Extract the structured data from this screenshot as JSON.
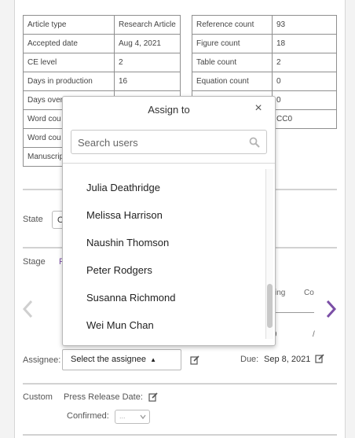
{
  "metadata_left": [
    {
      "key": "Article type",
      "value": "Research Article"
    },
    {
      "key": "Accepted date",
      "value": "Aug 4, 2021"
    },
    {
      "key": "CE level",
      "value": "2"
    },
    {
      "key": "Days in production",
      "value": "16"
    },
    {
      "key": "Days over",
      "value": ""
    },
    {
      "key": "Word cou",
      "value": ""
    },
    {
      "key": "Word cou",
      "value": ""
    },
    {
      "key": "Manuscrip",
      "value": ""
    }
  ],
  "metadata_right": [
    {
      "key": "Reference count",
      "value": "93"
    },
    {
      "key": "Figure count",
      "value": "18"
    },
    {
      "key": "Table count",
      "value": "2"
    },
    {
      "key": "Equation count",
      "value": "0"
    },
    {
      "key": "",
      "value": "0"
    },
    {
      "key": "",
      "value": "CC0"
    }
  ],
  "state": {
    "label": "State",
    "value": "O"
  },
  "stage": {
    "label": "Stage",
    "value": "P",
    "steps_visible": [
      {
        "label": "ing"
      },
      {
        "label": "Co"
      }
    ],
    "partial_values": [
      "9",
      "/"
    ]
  },
  "assignee": {
    "label": "Assignee:",
    "select_value": "Select the assignee",
    "caret": "▲"
  },
  "due": {
    "label": "Due:",
    "value": "Sep 8, 2021"
  },
  "custom": {
    "label": "Custom",
    "press_release_label": "Press Release Date:",
    "confirmed_label": "Confirmed:",
    "confirmed_value": "..."
  },
  "popup": {
    "title": "Assign to",
    "close_glyph": "×",
    "search_placeholder": "Search users",
    "users": [
      "Julia Deathridge",
      "Melissa Harrison",
      "Naushin Thomson",
      "Peter Rodgers",
      "Susanna Richmond",
      "Wei Mun Chan"
    ]
  },
  "colors": {
    "accent": "#7b4fa6",
    "border": "#8f8f8f",
    "text": "#333333"
  },
  "icons": [
    "search-icon",
    "close-icon",
    "edit-icon",
    "chevron-left-icon",
    "chevron-right-icon",
    "caret-up-icon",
    "chevron-down-icon"
  ]
}
